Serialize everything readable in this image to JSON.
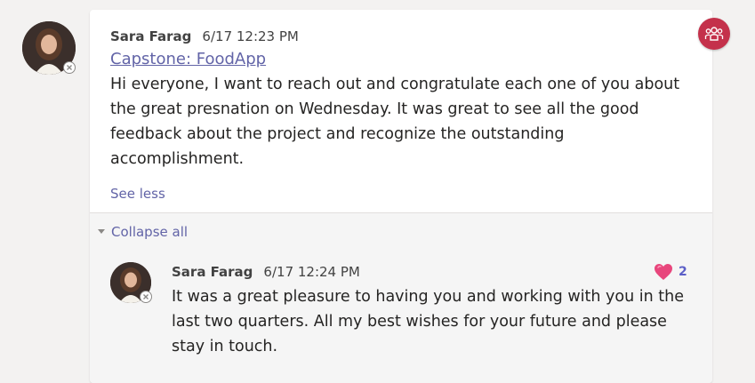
{
  "post": {
    "author": "Sara Farag",
    "timestamp": "6/17 12:23 PM",
    "subject": "Capstone: FoodApp",
    "body_lines": [
      "Hi everyone, I want to reach out and congratulate each one of you about",
      "the great presnation on Wednesday. It was great to see all the good",
      "feedback about the project and recognize the outstanding",
      "accomplishment."
    ],
    "see_less_label": "See less",
    "avatar_icon": "profile-photo",
    "status_icon": "offline-status-icon"
  },
  "thread": {
    "collapse_label": "Collapse all"
  },
  "reply": {
    "author": "Sara Farag",
    "timestamp": "6/17 12:24 PM",
    "body_lines": [
      "It was a great pleasure to having you and working with you in the",
      "last two quarters. All my best wishes for your future and please",
      "stay in touch."
    ],
    "reaction": {
      "icon": "heart-icon",
      "count": "2"
    }
  },
  "colors": {
    "accent": "#6264a7",
    "badge": "#c4314b",
    "heart": "#e8467c"
  }
}
